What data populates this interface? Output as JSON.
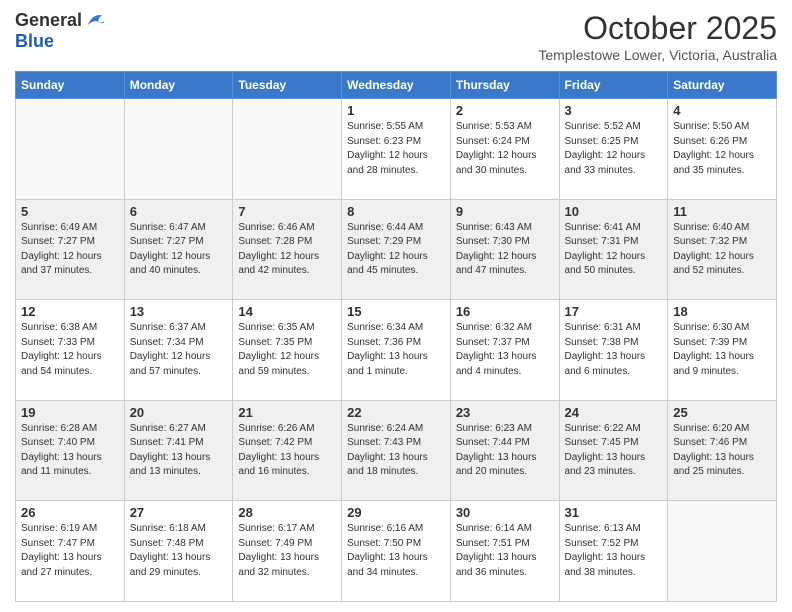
{
  "header": {
    "logo_line1": "General",
    "logo_line2": "Blue",
    "title": "October 2025",
    "subtitle": "Templestowe Lower, Victoria, Australia"
  },
  "days_of_week": [
    "Sunday",
    "Monday",
    "Tuesday",
    "Wednesday",
    "Thursday",
    "Friday",
    "Saturday"
  ],
  "weeks": [
    [
      {
        "day": "",
        "info": ""
      },
      {
        "day": "",
        "info": ""
      },
      {
        "day": "",
        "info": ""
      },
      {
        "day": "1",
        "info": "Sunrise: 5:55 AM\nSunset: 6:23 PM\nDaylight: 12 hours\nand 28 minutes."
      },
      {
        "day": "2",
        "info": "Sunrise: 5:53 AM\nSunset: 6:24 PM\nDaylight: 12 hours\nand 30 minutes."
      },
      {
        "day": "3",
        "info": "Sunrise: 5:52 AM\nSunset: 6:25 PM\nDaylight: 12 hours\nand 33 minutes."
      },
      {
        "day": "4",
        "info": "Sunrise: 5:50 AM\nSunset: 6:26 PM\nDaylight: 12 hours\nand 35 minutes."
      }
    ],
    [
      {
        "day": "5",
        "info": "Sunrise: 6:49 AM\nSunset: 7:27 PM\nDaylight: 12 hours\nand 37 minutes."
      },
      {
        "day": "6",
        "info": "Sunrise: 6:47 AM\nSunset: 7:27 PM\nDaylight: 12 hours\nand 40 minutes."
      },
      {
        "day": "7",
        "info": "Sunrise: 6:46 AM\nSunset: 7:28 PM\nDaylight: 12 hours\nand 42 minutes."
      },
      {
        "day": "8",
        "info": "Sunrise: 6:44 AM\nSunset: 7:29 PM\nDaylight: 12 hours\nand 45 minutes."
      },
      {
        "day": "9",
        "info": "Sunrise: 6:43 AM\nSunset: 7:30 PM\nDaylight: 12 hours\nand 47 minutes."
      },
      {
        "day": "10",
        "info": "Sunrise: 6:41 AM\nSunset: 7:31 PM\nDaylight: 12 hours\nand 50 minutes."
      },
      {
        "day": "11",
        "info": "Sunrise: 6:40 AM\nSunset: 7:32 PM\nDaylight: 12 hours\nand 52 minutes."
      }
    ],
    [
      {
        "day": "12",
        "info": "Sunrise: 6:38 AM\nSunset: 7:33 PM\nDaylight: 12 hours\nand 54 minutes."
      },
      {
        "day": "13",
        "info": "Sunrise: 6:37 AM\nSunset: 7:34 PM\nDaylight: 12 hours\nand 57 minutes."
      },
      {
        "day": "14",
        "info": "Sunrise: 6:35 AM\nSunset: 7:35 PM\nDaylight: 12 hours\nand 59 minutes."
      },
      {
        "day": "15",
        "info": "Sunrise: 6:34 AM\nSunset: 7:36 PM\nDaylight: 13 hours\nand 1 minute."
      },
      {
        "day": "16",
        "info": "Sunrise: 6:32 AM\nSunset: 7:37 PM\nDaylight: 13 hours\nand 4 minutes."
      },
      {
        "day": "17",
        "info": "Sunrise: 6:31 AM\nSunset: 7:38 PM\nDaylight: 13 hours\nand 6 minutes."
      },
      {
        "day": "18",
        "info": "Sunrise: 6:30 AM\nSunset: 7:39 PM\nDaylight: 13 hours\nand 9 minutes."
      }
    ],
    [
      {
        "day": "19",
        "info": "Sunrise: 6:28 AM\nSunset: 7:40 PM\nDaylight: 13 hours\nand 11 minutes."
      },
      {
        "day": "20",
        "info": "Sunrise: 6:27 AM\nSunset: 7:41 PM\nDaylight: 13 hours\nand 13 minutes."
      },
      {
        "day": "21",
        "info": "Sunrise: 6:26 AM\nSunset: 7:42 PM\nDaylight: 13 hours\nand 16 minutes."
      },
      {
        "day": "22",
        "info": "Sunrise: 6:24 AM\nSunset: 7:43 PM\nDaylight: 13 hours\nand 18 minutes."
      },
      {
        "day": "23",
        "info": "Sunrise: 6:23 AM\nSunset: 7:44 PM\nDaylight: 13 hours\nand 20 minutes."
      },
      {
        "day": "24",
        "info": "Sunrise: 6:22 AM\nSunset: 7:45 PM\nDaylight: 13 hours\nand 23 minutes."
      },
      {
        "day": "25",
        "info": "Sunrise: 6:20 AM\nSunset: 7:46 PM\nDaylight: 13 hours\nand 25 minutes."
      }
    ],
    [
      {
        "day": "26",
        "info": "Sunrise: 6:19 AM\nSunset: 7:47 PM\nDaylight: 13 hours\nand 27 minutes."
      },
      {
        "day": "27",
        "info": "Sunrise: 6:18 AM\nSunset: 7:48 PM\nDaylight: 13 hours\nand 29 minutes."
      },
      {
        "day": "28",
        "info": "Sunrise: 6:17 AM\nSunset: 7:49 PM\nDaylight: 13 hours\nand 32 minutes."
      },
      {
        "day": "29",
        "info": "Sunrise: 6:16 AM\nSunset: 7:50 PM\nDaylight: 13 hours\nand 34 minutes."
      },
      {
        "day": "30",
        "info": "Sunrise: 6:14 AM\nSunset: 7:51 PM\nDaylight: 13 hours\nand 36 minutes."
      },
      {
        "day": "31",
        "info": "Sunrise: 6:13 AM\nSunset: 7:52 PM\nDaylight: 13 hours\nand 38 minutes."
      },
      {
        "day": "",
        "info": ""
      }
    ]
  ]
}
